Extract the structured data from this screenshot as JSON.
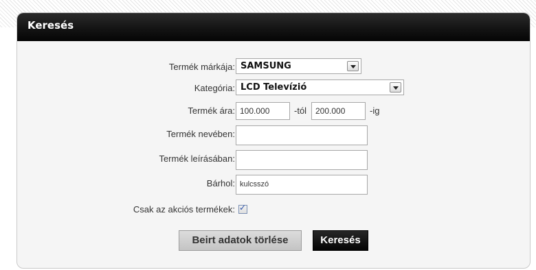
{
  "panel": {
    "title": "Keresés"
  },
  "form": {
    "brand": {
      "label": "Termék márkája:",
      "value": "SAMSUNG"
    },
    "category": {
      "label": "Kategória:",
      "value": "LCD Televízió"
    },
    "price": {
      "label": "Termék ára:",
      "from_value": "100.000",
      "from_suffix": "-tól",
      "to_value": "200.000",
      "to_suffix": "-ig"
    },
    "name": {
      "label": "Termék nevében:",
      "value": ""
    },
    "description": {
      "label": "Termék leírásában:",
      "value": ""
    },
    "anywhere": {
      "label": "Bárhol:",
      "value": "kulcsszó"
    },
    "sale_only": {
      "label": "Csak az akciós termékek:",
      "checked": true,
      "mark": "✓"
    }
  },
  "buttons": {
    "clear_label": "Beirt adatok törlése",
    "search_label": "Keresés"
  },
  "icons": {
    "dropdown": "chevron-down-icon",
    "check": "check-icon"
  },
  "colors": {
    "header_bg": "#111111",
    "panel_bg": "#f5f5f5",
    "search_button_bg": "#111111",
    "clear_button_bg": "#cfcfcf"
  }
}
